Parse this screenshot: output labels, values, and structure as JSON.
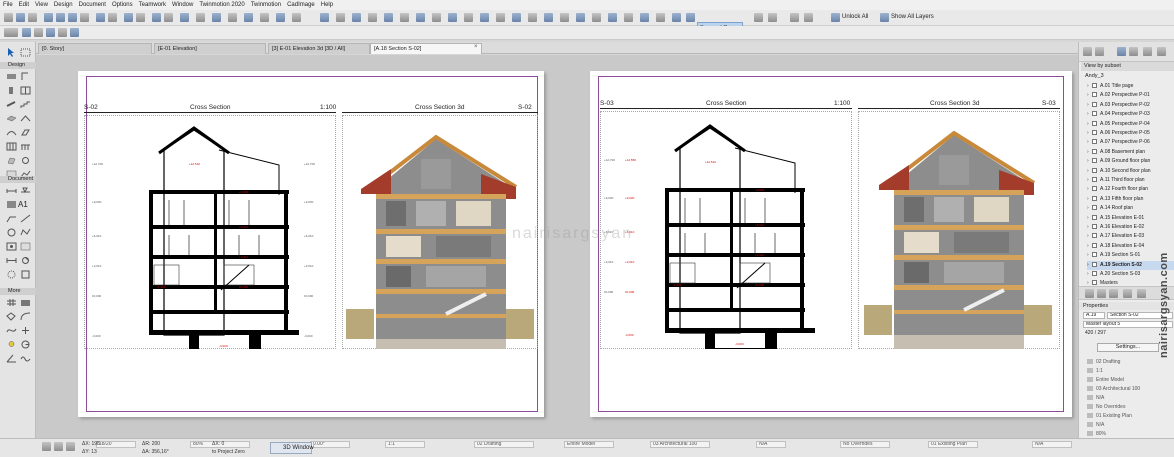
{
  "menu": [
    "File",
    "Edit",
    "View",
    "Design",
    "Document",
    "Options",
    "Teamwork",
    "Window",
    "Twinmotion 2020",
    "Twinmotion",
    "CadImage",
    "Help"
  ],
  "toolbar": {
    "suspend_groups": "Suspend Groups",
    "unlock_all": "Unlock All",
    "show_all_layers": "Show All Layers"
  },
  "tabs": [
    {
      "label": "[0. Story]"
    },
    {
      "label": "[E-01 Elevation]"
    },
    {
      "label": "[3] E-01 Elevation 3d [3D / All]"
    },
    {
      "label": "[A.18 Section S-02]"
    }
  ],
  "toolbox": {
    "design": "Design",
    "document": "Document",
    "more": "More",
    "text_tool": "A1"
  },
  "sheets": [
    {
      "left_code": "S-02",
      "left_title": "Cross Section",
      "scale": "1:100",
      "right_title": "Cross Section 3d",
      "right_code": "S-02"
    },
    {
      "left_code": "S-03",
      "left_title": "Cross Section",
      "scale": "1:100",
      "right_title": "Cross Section 3d",
      "right_code": "S-03"
    }
  ],
  "watermark": "nairisargsyan",
  "navigator": {
    "filter": "View by subset",
    "root": "Andy_3",
    "items": [
      "A.01 Title page",
      "A.02 Perspective P-01",
      "A.03 Perspective P-02",
      "A.04 Perspective P-03",
      "A.05 Perspective P-04",
      "A.06 Perspective P-05",
      "A.07 Perspective P-06",
      "A.08 Basement plan",
      "A.09 Ground floor plan",
      "A.10 Second floor plan",
      "A.11 Third floor plan",
      "A.12 Fourth floor plan",
      "A.13 Fifth floor plan",
      "A.14 Roof plan",
      "A.15 Elevation E-01",
      "A.16 Elevation E-02",
      "A.17 Elevation E-03",
      "A.18 Elevation E-04",
      "A.19 Section S-01",
      "A.19 Section S-02",
      "A.20 Section S-03",
      "Masters"
    ],
    "selected_index": 19,
    "properties_label": "Properties",
    "prop_id": "A.19",
    "prop_name": "Section S-02",
    "master_layout": "Master layout 5",
    "size": "420 / 297",
    "settings_label": "Settings...",
    "info": [
      "02 Drafting",
      "1:1",
      "Entire Model",
      "03 Architectural 100",
      "N/A",
      "No Overrides",
      "01 Existing Plan",
      "N/A",
      "80%",
      "N/A"
    ],
    "side_watermark": "nairisargsyan.com"
  },
  "status": {
    "page": "18/20",
    "zoom": "80%",
    "angle": "0.00°",
    "scale": "1:1",
    "layer": "02 Drafting",
    "model": "Entire Model",
    "penset": "03 Architectural 100",
    "na1": "N/A",
    "overrides": "No Overrides",
    "renovation": "01 Existing Plan",
    "na2": "N/A",
    "coord_dx": "ΔX: 198",
    "coord_dy": "ΔY: 13",
    "coord_r": "ΔR: 200",
    "coord_a": "ΔA: 356,16°",
    "coord_0": "ΔX: 0",
    "project_zero": "to Project Zero",
    "btn_3d": "3D Window"
  }
}
